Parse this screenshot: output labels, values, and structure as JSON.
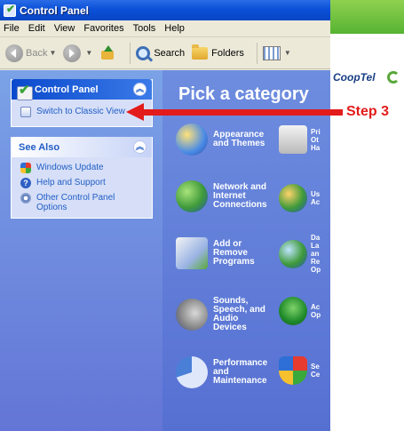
{
  "window": {
    "title": "Control Panel"
  },
  "menubar": {
    "items": [
      "File",
      "Edit",
      "View",
      "Favorites",
      "Tools",
      "Help"
    ]
  },
  "toolbar": {
    "back_label": "Back",
    "search_label": "Search",
    "folders_label": "Folders"
  },
  "left_pane": {
    "control_panel_box": {
      "title": "Control Panel",
      "link": "Switch to Classic View"
    },
    "see_also_box": {
      "title": "See Also",
      "links": [
        "Windows Update",
        "Help and Support",
        "Other Control Panel Options"
      ]
    }
  },
  "main": {
    "heading": "Pick a category",
    "categories": [
      "Appearance and Themes",
      "Network and Internet Connections",
      "Add or Remove Programs",
      "Sounds, Speech, and Audio Devices",
      "Performance and Maintenance"
    ],
    "right_column_partial": [
      "Pri Ot Ha",
      "Us Ac",
      "Da La an Re Op",
      "Ac Op",
      "Se Ce"
    ]
  },
  "branding": {
    "name": "CoopTel",
    "bar_color": "#6cbf3c"
  },
  "annotation": {
    "label": "Step 3",
    "color": "#e31b1b"
  },
  "icons": {
    "titlebar": "control-panel-icon",
    "back": "back-arrow-icon",
    "forward": "forward-arrow-icon",
    "up": "folder-up-icon",
    "search": "search-icon",
    "folders": "folders-icon",
    "views": "views-icon",
    "classic_view": "classic-view-icon",
    "windows_update": "windows-update-icon",
    "help": "help-icon",
    "other_options": "gear-icon"
  }
}
